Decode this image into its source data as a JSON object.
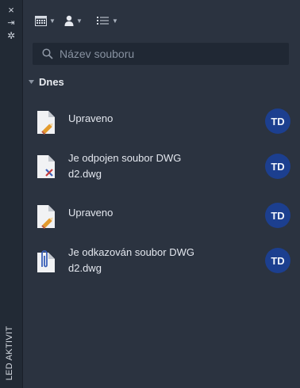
{
  "sidebar": {
    "close_icon": "×",
    "collapse_icon": "⇥",
    "settings_icon": "✲",
    "title": "LED AKTIVIT"
  },
  "toolbar": {
    "calendar_filter": "calendar-icon",
    "user_filter": "user-icon",
    "list_view": "list-icon"
  },
  "search": {
    "placeholder": "Název souboru",
    "value": ""
  },
  "section": {
    "label": "Dnes"
  },
  "activities": [
    {
      "line1": "Upraveno",
      "line2": "",
      "icon": "edited-file-icon",
      "avatar": "TD"
    },
    {
      "line1": "Je odpojen soubor DWG",
      "line2": "d2.dwg",
      "icon": "detached-file-icon",
      "avatar": "TD"
    },
    {
      "line1": "Upraveno",
      "line2": "",
      "icon": "edited-file-icon",
      "avatar": "TD"
    },
    {
      "line1": "Je odkazován soubor DWG",
      "line2": "d2.dwg",
      "icon": "attached-file-icon",
      "avatar": "TD"
    }
  ],
  "colors": {
    "background": "#2b3340",
    "sidebar": "#222a35",
    "avatar": "#1c3f8f",
    "pencil": "#e39b2d"
  }
}
